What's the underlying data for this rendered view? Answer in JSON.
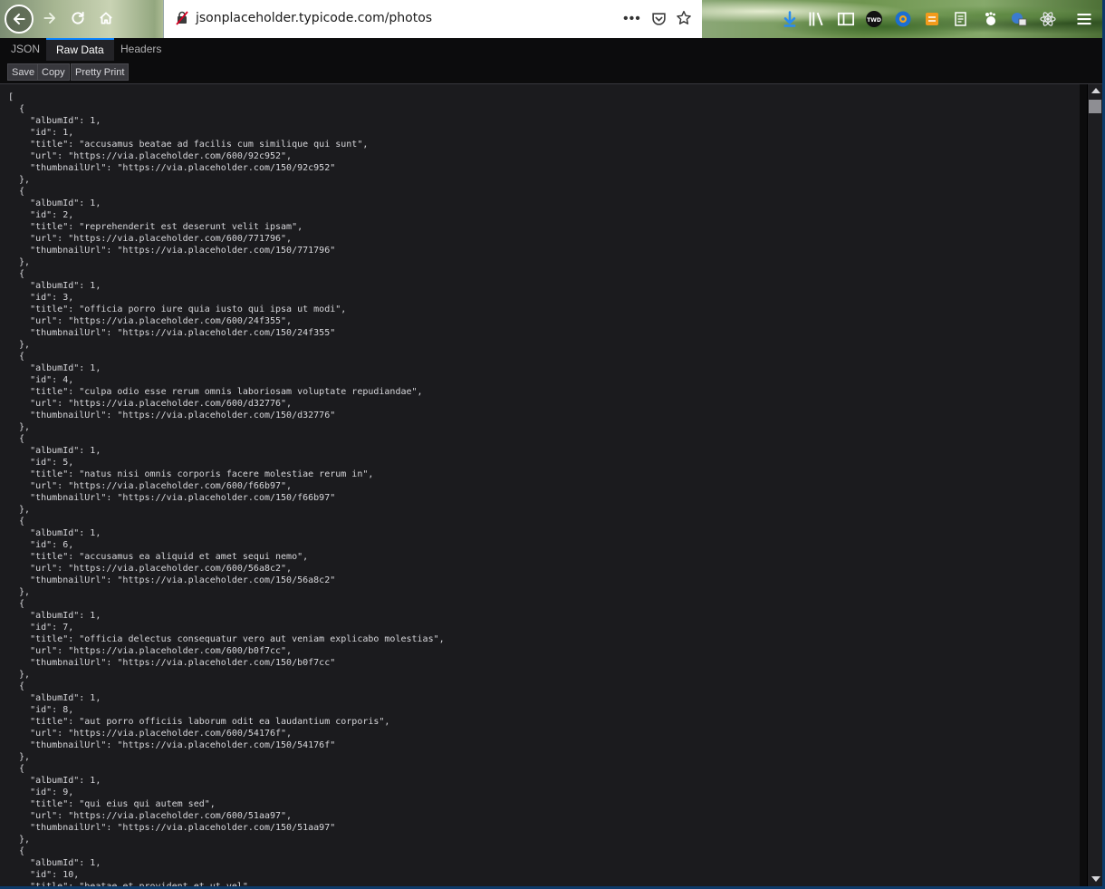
{
  "browser": {
    "url": "jsonplaceholder.typicode.com/photos",
    "more_label": "•••"
  },
  "viewer": {
    "tabs": [
      {
        "label": "JSON"
      },
      {
        "label": "Raw Data"
      },
      {
        "label": "Headers"
      }
    ],
    "buttons": {
      "save": "Save",
      "copy": "Copy",
      "pretty_print": "Pretty Print"
    }
  },
  "raw_json": "[\n  {\n    \"albumId\": 1,\n    \"id\": 1,\n    \"title\": \"accusamus beatae ad facilis cum similique qui sunt\",\n    \"url\": \"https://via.placeholder.com/600/92c952\",\n    \"thumbnailUrl\": \"https://via.placeholder.com/150/92c952\"\n  },\n  {\n    \"albumId\": 1,\n    \"id\": 2,\n    \"title\": \"reprehenderit est deserunt velit ipsam\",\n    \"url\": \"https://via.placeholder.com/600/771796\",\n    \"thumbnailUrl\": \"https://via.placeholder.com/150/771796\"\n  },\n  {\n    \"albumId\": 1,\n    \"id\": 3,\n    \"title\": \"officia porro iure quia iusto qui ipsa ut modi\",\n    \"url\": \"https://via.placeholder.com/600/24f355\",\n    \"thumbnailUrl\": \"https://via.placeholder.com/150/24f355\"\n  },\n  {\n    \"albumId\": 1,\n    \"id\": 4,\n    \"title\": \"culpa odio esse rerum omnis laboriosam voluptate repudiandae\",\n    \"url\": \"https://via.placeholder.com/600/d32776\",\n    \"thumbnailUrl\": \"https://via.placeholder.com/150/d32776\"\n  },\n  {\n    \"albumId\": 1,\n    \"id\": 5,\n    \"title\": \"natus nisi omnis corporis facere molestiae rerum in\",\n    \"url\": \"https://via.placeholder.com/600/f66b97\",\n    \"thumbnailUrl\": \"https://via.placeholder.com/150/f66b97\"\n  },\n  {\n    \"albumId\": 1,\n    \"id\": 6,\n    \"title\": \"accusamus ea aliquid et amet sequi nemo\",\n    \"url\": \"https://via.placeholder.com/600/56a8c2\",\n    \"thumbnailUrl\": \"https://via.placeholder.com/150/56a8c2\"\n  },\n  {\n    \"albumId\": 1,\n    \"id\": 7,\n    \"title\": \"officia delectus consequatur vero aut veniam explicabo molestias\",\n    \"url\": \"https://via.placeholder.com/600/b0f7cc\",\n    \"thumbnailUrl\": \"https://via.placeholder.com/150/b0f7cc\"\n  },\n  {\n    \"albumId\": 1,\n    \"id\": 8,\n    \"title\": \"aut porro officiis laborum odit ea laudantium corporis\",\n    \"url\": \"https://via.placeholder.com/600/54176f\",\n    \"thumbnailUrl\": \"https://via.placeholder.com/150/54176f\"\n  },\n  {\n    \"albumId\": 1,\n    \"id\": 9,\n    \"title\": \"qui eius qui autem sed\",\n    \"url\": \"https://via.placeholder.com/600/51aa97\",\n    \"thumbnailUrl\": \"https://via.placeholder.com/150/51aa97\"\n  },\n  {\n    \"albumId\": 1,\n    \"id\": 10,\n    \"title\": \"beatae et provident et ut vel\",",
  "colors": {
    "accent": "#0a84ff",
    "content_bg": "#1b1b1e",
    "chrome_bg": "#0c0c0d"
  }
}
